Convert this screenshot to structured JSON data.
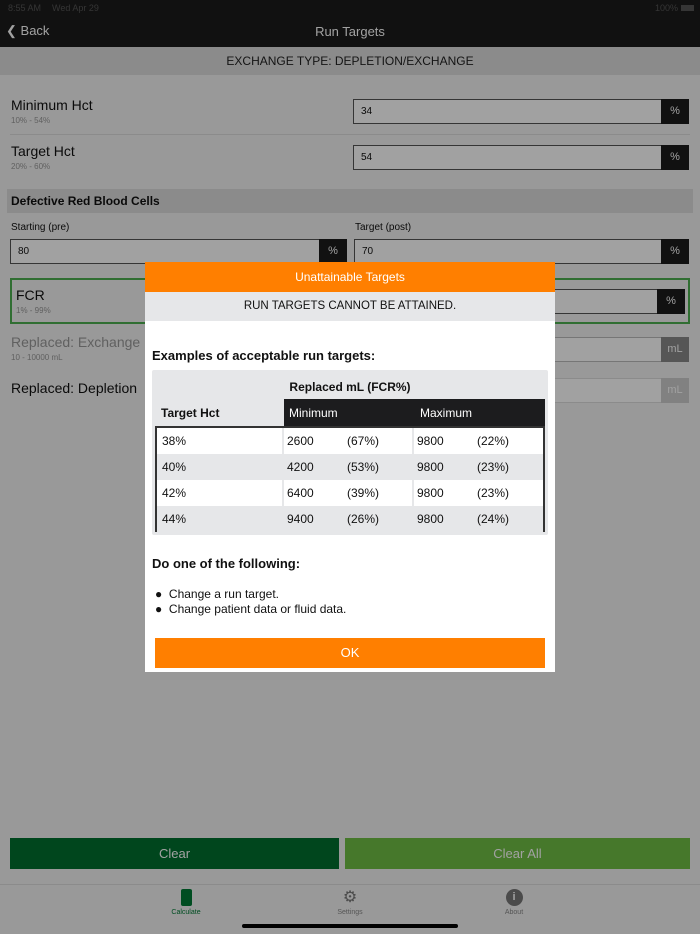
{
  "status": {
    "time": "8:55 AM",
    "date": "Wed Apr 29",
    "battery": "100%"
  },
  "nav": {
    "back": "Back",
    "title": "Run Targets"
  },
  "exchange_type": "EXCHANGE TYPE: DEPLETION/EXCHANGE",
  "fields": {
    "min_hct": {
      "label": "Minimum Hct",
      "range": "10% - 54%",
      "value": "34",
      "unit": "%"
    },
    "target_hct": {
      "label": "Target Hct",
      "range": "20% - 60%",
      "value": "54",
      "unit": "%"
    },
    "section": "Defective Red Blood Cells",
    "starting": {
      "label": "Starting (pre)",
      "value": "80",
      "unit": "%"
    },
    "target": {
      "label": "Target (post)",
      "value": "70",
      "unit": "%"
    },
    "fcr": {
      "label": "FCR",
      "range": "1% - 99%",
      "unit": "%"
    },
    "rep_exchange": {
      "label": "Replaced: Exchange",
      "range": "10 - 10000 mL",
      "unit": "mL"
    },
    "rep_depletion": {
      "label": "Replaced: Depletion",
      "unit": "mL"
    }
  },
  "buttons": {
    "clear": "Clear",
    "clear_all": "Clear All"
  },
  "tabs": [
    {
      "label": "Calculate"
    },
    {
      "label": "Settings"
    },
    {
      "label": "About"
    }
  ],
  "modal": {
    "title": "Unattainable Targets",
    "subtitle": "RUN TARGETS CANNOT BE ATTAINED.",
    "examples_heading": "Examples of acceptable run targets:",
    "table": {
      "group_header": "Replaced mL (FCR%)",
      "col_target": "Target Hct",
      "col_min": "Minimum",
      "col_max": "Maximum",
      "rows": [
        {
          "hct": "38%",
          "min": "2600",
          "min_fcr": "(67%)",
          "max": "9800",
          "max_fcr": "(22%)"
        },
        {
          "hct": "40%",
          "min": "4200",
          "min_fcr": "(53%)",
          "max": "9800",
          "max_fcr": "(23%)"
        },
        {
          "hct": "42%",
          "min": "6400",
          "min_fcr": "(39%)",
          "max": "9800",
          "max_fcr": "(23%)"
        },
        {
          "hct": "44%",
          "min": "9400",
          "min_fcr": "(26%)",
          "max": "9800",
          "max_fcr": "(24%)"
        }
      ]
    },
    "do_heading": "Do one of the following:",
    "bullets": [
      "Change a run target.",
      "Change patient data or fluid data."
    ],
    "ok": "OK"
  },
  "colors": {
    "orange": "#ff7f00",
    "dark_green": "#00702f",
    "light_green": "#5fb340"
  }
}
